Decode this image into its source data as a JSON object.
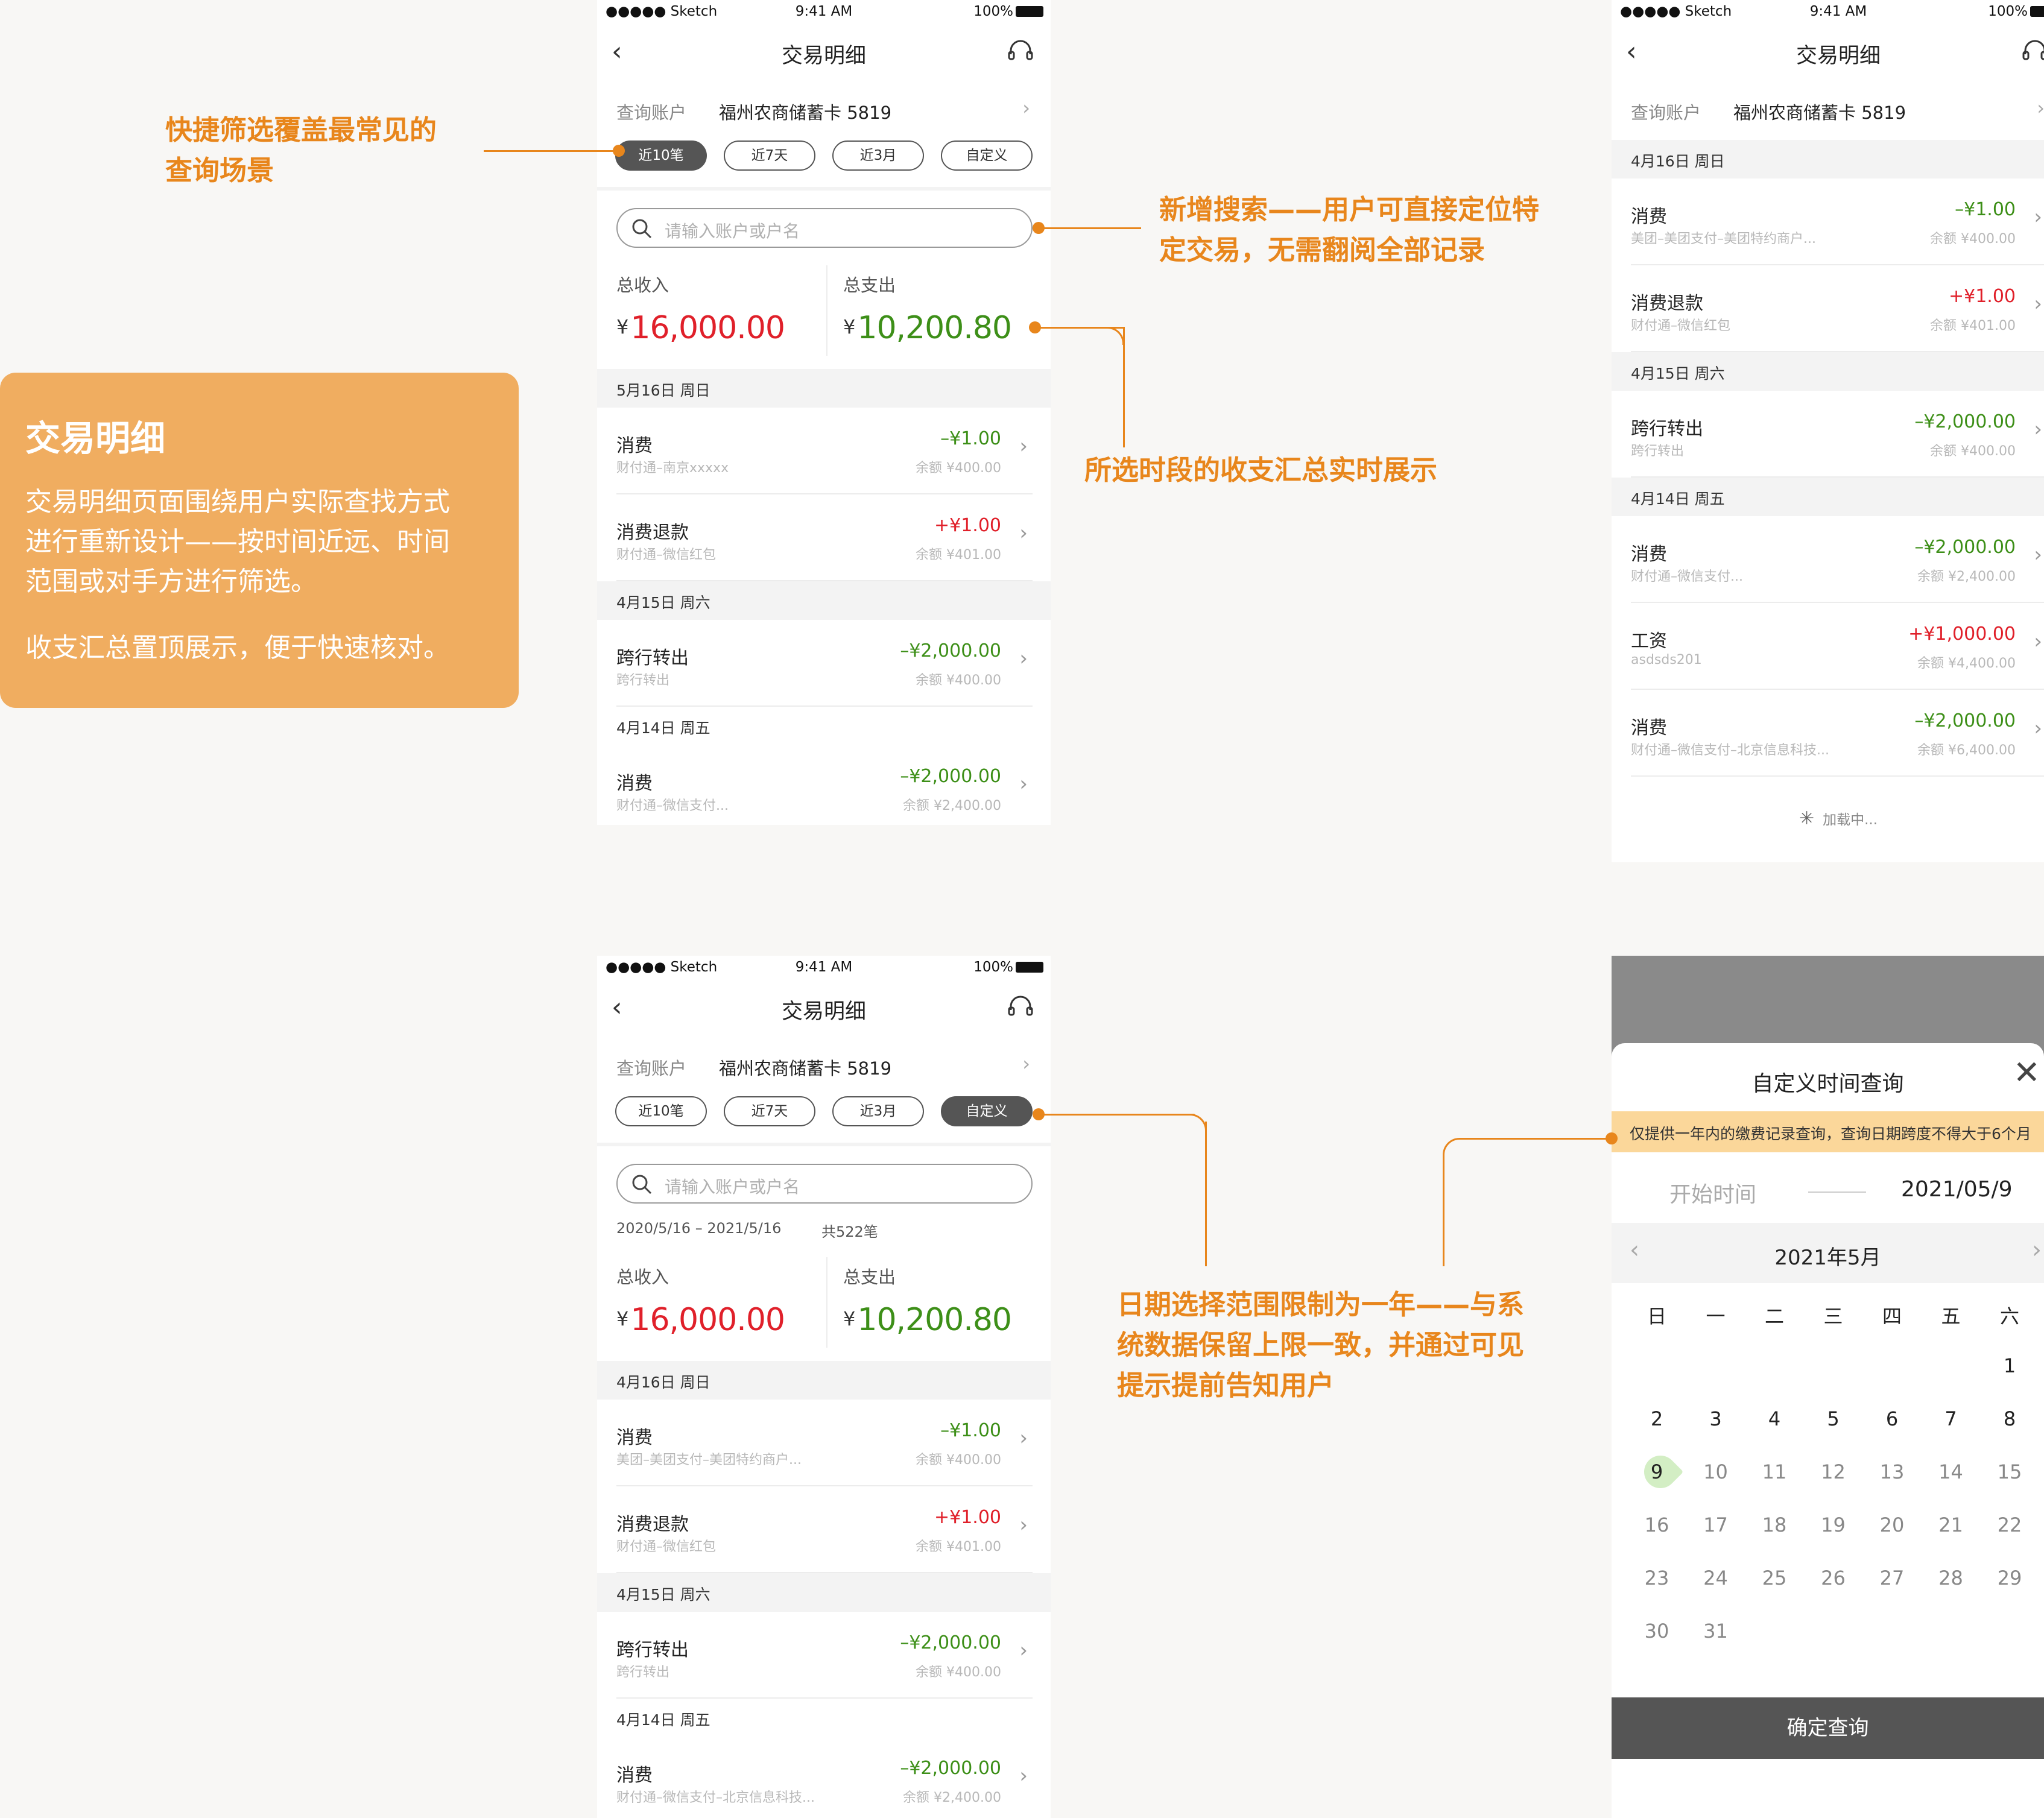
{
  "status_bar": {
    "carrier": "●●●●● Sketch",
    "time": "9:41 AM",
    "battery": "100%"
  },
  "nav": {
    "title": "交易明细"
  },
  "account": {
    "label": "查询账户",
    "value": "福州农商储蓄卡 5819"
  },
  "chips": [
    "近10笔",
    "近7天",
    "近3月",
    "自定义"
  ],
  "search": {
    "placeholder": "请输入账户或户名"
  },
  "summary": {
    "income_label": "总收入",
    "income": "16,000.00",
    "expense_label": "总支出",
    "expense": "10,200.80",
    "currency": "¥"
  },
  "screen1": {
    "sections": [
      {
        "date": "5月16日 周日",
        "rows": [
          {
            "title": "消费",
            "sub": "财付通–南京xxxxx",
            "amount": "–¥1.00",
            "balance": "余额 ¥400.00",
            "type": "out"
          },
          {
            "title": "消费退款",
            "sub": "财付通–微信红包",
            "amount": "+¥1.00",
            "balance": "余额 ¥401.00",
            "type": "in"
          }
        ]
      },
      {
        "date": "4月15日 周六",
        "rows": [
          {
            "title": "跨行转出",
            "sub": "跨行转出",
            "amount": "–¥2,000.00",
            "balance": "余额 ¥400.00",
            "type": "out"
          }
        ]
      },
      {
        "date": "4月14日 周五",
        "rows": [
          {
            "title": "消费",
            "sub": "财付通–微信支付...",
            "amount": "–¥2,000.00",
            "balance": "余额 ¥2,400.00",
            "type": "out"
          }
        ]
      }
    ]
  },
  "screen2": {
    "sections": [
      {
        "date": "4月16日 周日",
        "rows": [
          {
            "title": "消费",
            "sub": "美团–美团支付–美团特约商户...",
            "amount": "–¥1.00",
            "balance": "余额 ¥400.00",
            "type": "out"
          },
          {
            "title": "消费退款",
            "sub": "财付通–微信红包",
            "amount": "+¥1.00",
            "balance": "余额 ¥401.00",
            "type": "in"
          }
        ]
      },
      {
        "date": "4月15日 周六",
        "rows": [
          {
            "title": "跨行转出",
            "sub": "跨行转出",
            "amount": "–¥2,000.00",
            "balance": "余额 ¥400.00",
            "type": "out"
          }
        ]
      },
      {
        "date": "4月14日 周五",
        "rows": [
          {
            "title": "消费",
            "sub": "财付通–微信支付...",
            "amount": "–¥2,000.00",
            "balance": "余额 ¥2,400.00",
            "type": "out"
          },
          {
            "title": "工资",
            "sub": "asdsds201",
            "amount": "+¥1,000.00",
            "balance": "余额 ¥4,400.00",
            "type": "in"
          },
          {
            "title": "消费",
            "sub": "财付通–微信支付–北京信息科技...",
            "amount": "–¥2,000.00",
            "balance": "余额 ¥6,400.00",
            "type": "out"
          }
        ]
      }
    ],
    "loading": "加载中..."
  },
  "screen3": {
    "range": "2020/5/16 – 2021/5/16",
    "count": "共522笔",
    "sections": [
      {
        "date": "4月16日 周日",
        "rows": [
          {
            "title": "消费",
            "sub": "美团–美团支付–美团特约商户...",
            "amount": "–¥1.00",
            "balance": "余额 ¥400.00",
            "type": "out"
          },
          {
            "title": "消费退款",
            "sub": "财付通–微信红包",
            "amount": "+¥1.00",
            "balance": "余额 ¥401.00",
            "type": "in"
          }
        ]
      },
      {
        "date": "4月15日 周六",
        "rows": [
          {
            "title": "跨行转出",
            "sub": "跨行转出",
            "amount": "–¥2,000.00",
            "balance": "余额 ¥400.00",
            "type": "out"
          }
        ]
      },
      {
        "date": "4月14日 周五",
        "rows": [
          {
            "title": "消费",
            "sub": "财付通–微信支付–北京信息科技...",
            "amount": "–¥2,000.00",
            "balance": "余额 ¥2,400.00",
            "type": "out"
          }
        ]
      }
    ]
  },
  "modal": {
    "title": "自定义时间查询",
    "notice": "仅提供一年内的缴费记录查询，查询日期跨度不得大于6个月",
    "start_placeholder": "开始时间",
    "end_value": "2021/05/9",
    "month": "2021年5月",
    "weekdays": [
      "日",
      "一",
      "二",
      "三",
      "四",
      "五",
      "六"
    ],
    "weeks": [
      [
        "",
        "",
        "",
        "",
        "",
        "",
        "1"
      ],
      [
        "2",
        "3",
        "4",
        "5",
        "6",
        "7",
        "8"
      ],
      [
        "9",
        "10",
        "11",
        "12",
        "13",
        "14",
        "15"
      ],
      [
        "16",
        "17",
        "18",
        "19",
        "20",
        "21",
        "22"
      ],
      [
        "23",
        "24",
        "25",
        "26",
        "27",
        "28",
        "29"
      ],
      [
        "30",
        "31",
        "",
        "",
        "",
        "",
        ""
      ]
    ],
    "selected_day": "9",
    "confirm": "确定查询"
  },
  "callouts": {
    "quick_filter": [
      "快捷筛选覆盖最常见的",
      "查询场景"
    ],
    "search": [
      "新增搜索——用户可直接定位特",
      "定交易，无需翻阅全部记录"
    ],
    "summary": [
      "所选时段的收支汇总实时展示"
    ],
    "date_range": [
      "日期选择范围限制为一年——与系",
      "统数据保留上限一致，并通过可见",
      "提示提前告知用户"
    ]
  },
  "info_card": {
    "title": "交易明细",
    "lines": [
      "交易明细页面围绕用户实际查找方式",
      "进行重新设计——按时间近远、时间",
      "范围或对手方进行筛选。"
    ],
    "line2": "收支汇总置顶展示，便于快速核对。"
  },
  "colors": {
    "accent": "#e8861c",
    "income": "#e0202a",
    "expense": "#3d8f18",
    "card": "#f0ad60"
  }
}
